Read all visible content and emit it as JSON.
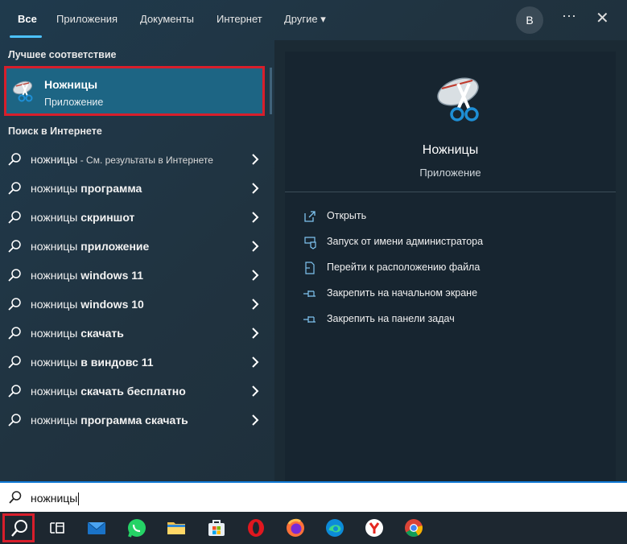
{
  "tabs": [
    {
      "label": "Все",
      "active": true
    },
    {
      "label": "Приложения"
    },
    {
      "label": "Документы"
    },
    {
      "label": "Интернет"
    },
    {
      "label": "Другие"
    }
  ],
  "header": {
    "avatar_letter": "В",
    "more_glyph": "⋯",
    "close_glyph": "✕",
    "dropdown_glyph": "▾"
  },
  "best_match": {
    "section_title": "Лучшее соответствие",
    "name": "Ножницы",
    "type": "Приложение",
    "icon": "snipping-tool-icon"
  },
  "web": {
    "section_title": "Поиск в Интернете",
    "items": [
      {
        "query": "ножницы",
        "suffix": " - См. результаты в Интернете",
        "suffix_small": true
      },
      {
        "query": "ножницы",
        "suffix": " программа"
      },
      {
        "query": "ножницы",
        "suffix": " скриншот"
      },
      {
        "query": "ножницы",
        "suffix": " приложение"
      },
      {
        "query": "ножницы",
        "suffix": " windows 11"
      },
      {
        "query": "ножницы",
        "suffix": " windows 10"
      },
      {
        "query": "ножницы",
        "suffix": " скачать"
      },
      {
        "query": "ножницы",
        "suffix": " в виндовс 11"
      },
      {
        "query": "ножницы",
        "suffix": " скачать бесплатно"
      },
      {
        "query": "ножницы",
        "suffix": " программа скачать"
      }
    ]
  },
  "preview": {
    "name": "Ножницы",
    "type": "Приложение",
    "actions": [
      {
        "label": "Открыть",
        "icon": "open-icon"
      },
      {
        "label": "Запуск от имени администратора",
        "icon": "admin-shield-icon"
      },
      {
        "label": "Перейти к расположению файла",
        "icon": "file-location-icon"
      },
      {
        "label": "Закрепить на начальном экране",
        "icon": "pin-icon"
      },
      {
        "label": "Закрепить на панели задач",
        "icon": "pin-icon"
      }
    ]
  },
  "search": {
    "value": "ножницы",
    "icon": "search-icon"
  },
  "taskbar": {
    "apps": [
      "search-icon",
      "task-view-icon",
      "mail-icon",
      "whatsapp-icon",
      "file-explorer-icon",
      "microsoft-store-icon",
      "opera-icon",
      "firefox-icon",
      "edge-icon",
      "yandex-browser-icon",
      "chrome-icon"
    ]
  },
  "colors": {
    "accent": "#4cc2ff",
    "highlight_border": "#d81e2b",
    "selected_bg": "#1d6584"
  }
}
